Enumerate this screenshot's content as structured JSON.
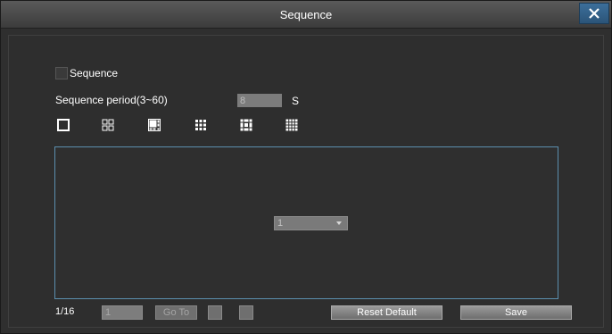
{
  "window": {
    "title": "Sequence"
  },
  "sequence": {
    "checkbox_label": "Sequence",
    "checked": false,
    "period_label": "Sequence period(3~60)",
    "period_value": "8",
    "period_unit": "S"
  },
  "layouts": [
    {
      "name": "1-split"
    },
    {
      "name": "4-split"
    },
    {
      "name": "6-split"
    },
    {
      "name": "9-split"
    },
    {
      "name": "8-split"
    },
    {
      "name": "16-split"
    }
  ],
  "preview": {
    "channel_select_value": "1"
  },
  "pager": {
    "page_indicator": "1/16",
    "page_input_value": "1",
    "goto_label": "Go To"
  },
  "footer": {
    "reset_label": "Reset Default",
    "save_label": "Save"
  },
  "colors": {
    "titlebar": "#4a4a4a",
    "close_button": "#3c6f9b",
    "preview_border": "#5b8fae",
    "background": "#2e2e2e"
  }
}
